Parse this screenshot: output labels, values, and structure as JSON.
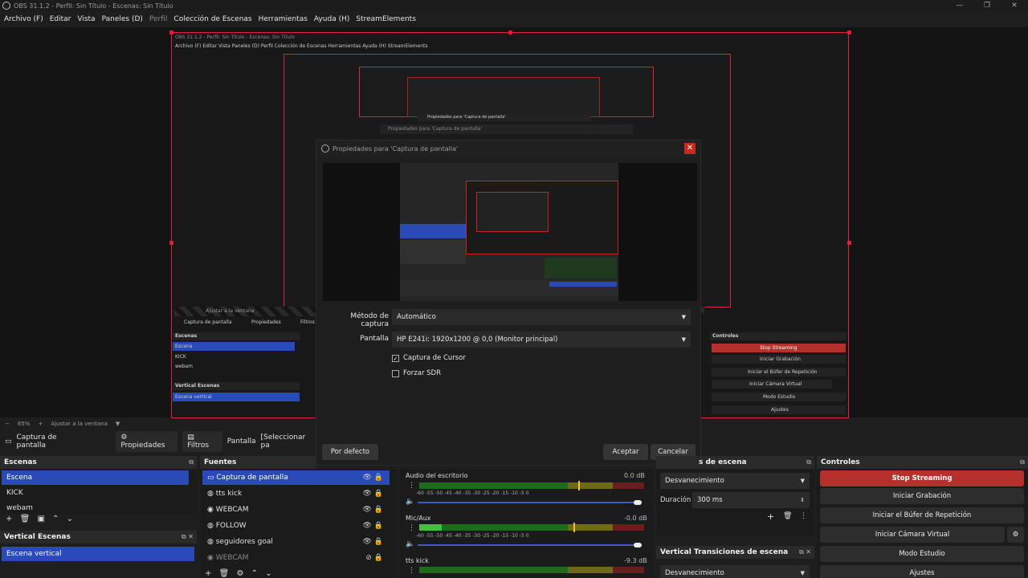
{
  "window": {
    "title": "OBS 31.1.2 - Perfil: Sin Título - Escenas: Sin Título",
    "controls": [
      "—",
      "❐",
      "✕"
    ]
  },
  "menu": [
    "Archivo (F)",
    "Editar",
    "Vista",
    "Paneles (D)",
    "Perfil",
    "Colección de Escenas",
    "Herramientas",
    "Ayuda (H)",
    "StreamElements"
  ],
  "nested": {
    "title": "OBS 31.1.2 - Perfil: Sin Título - Escenas: Sin Título",
    "menu": "Archivo (F)   Editar   Vista   Paneles (D)   Perfil   Colección de Escenas   Herramientas   Ayuda (H)   StreamElements",
    "source_name": "Captura de pantalla",
    "props": "Propiedades",
    "filters": "Filtros",
    "scenes_title": "Escenas",
    "scenes": [
      "Escena",
      "KICK",
      "webam"
    ],
    "vertical_title": "Vertical Escenas",
    "vertical_scene": "Escena vertical",
    "controls_title": "Controles",
    "controls": [
      "Stop Streaming",
      "Iniciar Grabación",
      "Iniciar el Búfer de Repetición",
      "Iniciar Cámara Virtual",
      "Modo Estudio",
      "Ajustes"
    ],
    "zoom": "Ajustar a la ventana",
    "popup_title": "Propiedades para 'Captura de pantalla'"
  },
  "dialog": {
    "title": "Propiedades para 'Captura de pantalla'",
    "method_label": "Método de captura",
    "method_value": "Automático",
    "screen_label": "Pantalla",
    "screen_value": "HP E241i: 1920x1200 @ 0,0 (Monitor principal)",
    "cursor_label": "Captura de Cursor",
    "cursor_checked": true,
    "sdr_label": "Forzar SDR",
    "sdr_checked": false,
    "default_btn": "Por defecto",
    "ok_btn": "Aceptar",
    "cancel_btn": "Cancelar"
  },
  "zoombar": {
    "minus": "−",
    "zoom": "65%",
    "plus": "+",
    "fit": "Ajustar a la ventana"
  },
  "source_toolbar": {
    "name": "Captura de pantalla",
    "properties": "Propiedades",
    "filters": "Filtros",
    "display": "Pantalla",
    "select": "[Seleccionar pa"
  },
  "scenes": {
    "title": "Escenas",
    "items": [
      "Escena",
      "KICK",
      "webam"
    ],
    "selected": 0
  },
  "vertical_scenes": {
    "title": "Vertical Escenas",
    "items": [
      "Escena vertical"
    ]
  },
  "sources": {
    "title": "Fuentes",
    "items": [
      {
        "name": "Captura de pantalla",
        "icon": "monitor-icon",
        "selected": true
      },
      {
        "name": "tts kick",
        "icon": "globe-icon",
        "selected": false
      },
      {
        "name": "WEBCAM",
        "icon": "camera-icon",
        "selected": false
      },
      {
        "name": "FOLLOW",
        "icon": "globe-icon",
        "selected": false
      },
      {
        "name": "seguidores goal",
        "icon": "globe-icon",
        "selected": false
      },
      {
        "name": "WEBCAM",
        "icon": "camera-icon",
        "selected": false,
        "hidden": true
      }
    ]
  },
  "mixer": {
    "channels": [
      {
        "name": "Audio del escritorio",
        "db": "0.0 dB",
        "level": 0.79
      },
      {
        "name": "Mic/Aux",
        "db": "-0.0 dB",
        "level": 0.1
      },
      {
        "name": "tts kick",
        "db": "-9.3 dB",
        "level": 0.0
      }
    ],
    "scale": "-60  -55  -50  -45  -40  -35  -30  -25  -20  -15  -10  -5  0"
  },
  "transitions": {
    "title": "s de escena",
    "fade": "Desvanecimiento",
    "duration_label": "Duración",
    "duration_value": "300 ms",
    "vertical_title": "Vertical Transiciones de escena",
    "vertical_fade": "Desvanecimiento"
  },
  "controls": {
    "title": "Controles",
    "stop_streaming": "Stop Streaming",
    "start_recording": "Iniciar Grabación",
    "replay_buffer": "Iniciar el Búfer de Repetición",
    "virtual_cam": "Iniciar Cámara Virtual",
    "studio_mode": "Modo Estudio",
    "settings": "Ajustes"
  },
  "colors": {
    "accent": "#2a4bb5",
    "stream_red": "#b5302b",
    "bounds_red": "#d8253d"
  }
}
